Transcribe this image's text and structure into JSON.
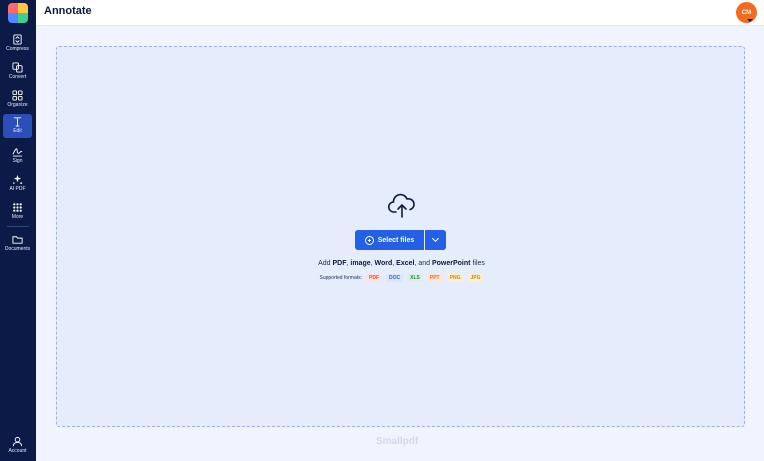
{
  "header": {
    "title": "Annotate",
    "avatar_initials": "CM"
  },
  "sidebar": {
    "items": [
      {
        "label": "Compress",
        "icon": "compress-icon"
      },
      {
        "label": "Convert",
        "icon": "convert-icon"
      },
      {
        "label": "Organize",
        "icon": "organize-icon"
      },
      {
        "label": "Edit",
        "icon": "text-edit-icon",
        "active": true
      },
      {
        "label": "Sign",
        "icon": "signature-icon"
      },
      {
        "label": "AI PDF",
        "icon": "sparkle-icon"
      },
      {
        "label": "More",
        "icon": "grid-icon"
      },
      {
        "label": "Documents",
        "icon": "folder-icon"
      }
    ],
    "account_label": "Account"
  },
  "dropzone": {
    "select_label": "Select files",
    "add_text": {
      "prefix": "Add ",
      "pdf": "PDF",
      "sep1": ", ",
      "image": "image",
      "sep2": ", ",
      "word": "Word",
      "sep3": ", ",
      "excel": "Excel",
      "sep4": ", and ",
      "powerpoint": "PowerPoint",
      "suffix": " files"
    },
    "formats_label": "Supported formats:",
    "formats": [
      {
        "label": "PDF",
        "color": "#e5483b",
        "bg": "#fde3df"
      },
      {
        "label": "DOC",
        "color": "#2f5fd8",
        "bg": "#dce6fb"
      },
      {
        "label": "XLS",
        "color": "#2f8a4e",
        "bg": "#dbefe1"
      },
      {
        "label": "PPT",
        "color": "#e06b21",
        "bg": "#fde6d6"
      },
      {
        "label": "PNG",
        "color": "#c98a0a",
        "bg": "#fcefcf"
      },
      {
        "label": "JPG",
        "color": "#c98a0a",
        "bg": "#fcefcf"
      }
    ]
  },
  "watermark": "Smallpdf",
  "colors": {
    "sidebar": "#0b1a46",
    "accent": "#2360e6",
    "avatar": "#f26b21"
  }
}
